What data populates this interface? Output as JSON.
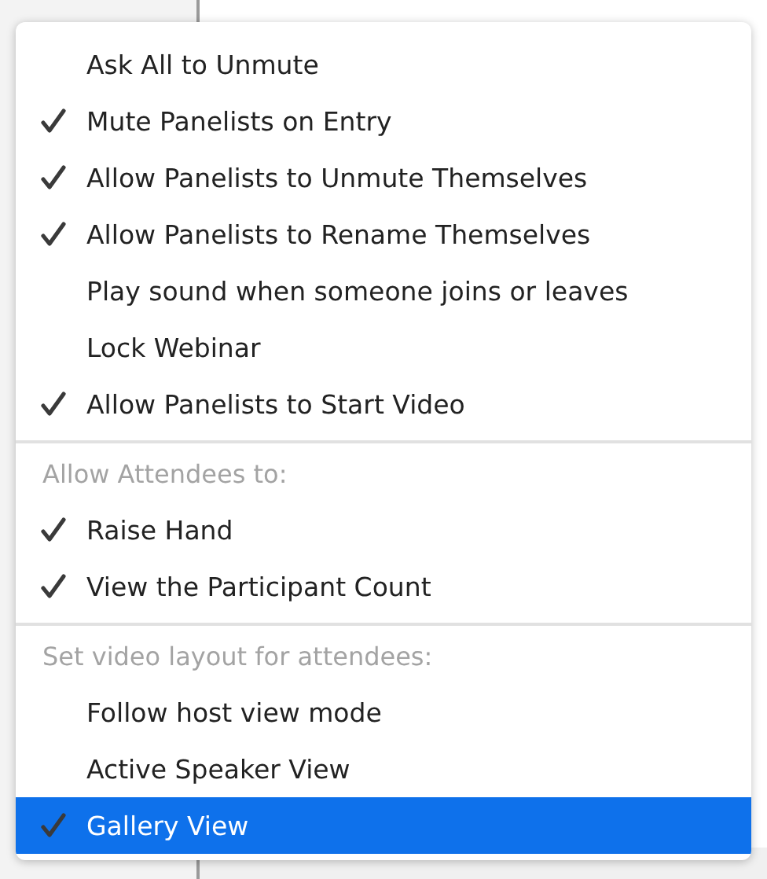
{
  "menu": {
    "sections": [
      {
        "items": [
          {
            "label": "Ask All to Unmute",
            "checked": false,
            "selected": false
          },
          {
            "label": "Mute Panelists on Entry",
            "checked": true,
            "selected": false
          },
          {
            "label": "Allow Panelists to Unmute Themselves",
            "checked": true,
            "selected": false
          },
          {
            "label": "Allow Panelists to Rename Themselves",
            "checked": true,
            "selected": false
          },
          {
            "label": "Play sound when someone joins or leaves",
            "checked": false,
            "selected": false
          },
          {
            "label": "Lock Webinar",
            "checked": false,
            "selected": false
          },
          {
            "label": "Allow Panelists to Start Video",
            "checked": true,
            "selected": false
          }
        ]
      },
      {
        "header": "Allow Attendees to:",
        "items": [
          {
            "label": "Raise Hand",
            "checked": true,
            "selected": false
          },
          {
            "label": "View the Participant Count",
            "checked": true,
            "selected": false
          }
        ]
      },
      {
        "header": "Set video layout for attendees:",
        "items": [
          {
            "label": "Follow host view mode",
            "checked": false,
            "selected": false
          },
          {
            "label": "Active Speaker View",
            "checked": false,
            "selected": false
          },
          {
            "label": "Gallery View",
            "checked": true,
            "selected": true
          }
        ]
      }
    ]
  }
}
